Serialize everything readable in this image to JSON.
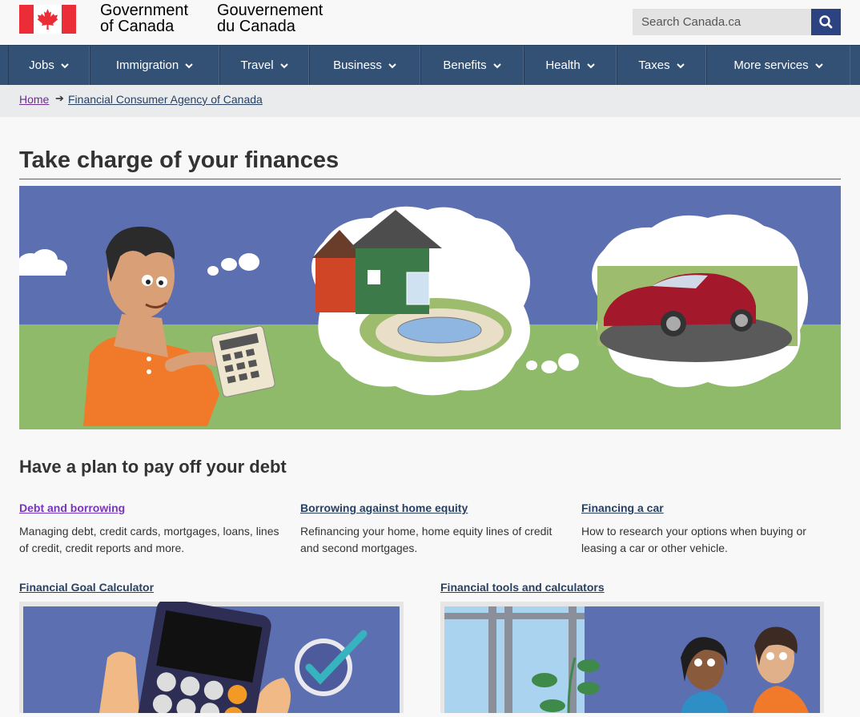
{
  "header": {
    "signature_en_line1": "Government",
    "signature_en_line2": "of Canada",
    "signature_fr_line1": "Gouvernement",
    "signature_fr_line2": "du Canada",
    "search_placeholder": "Search Canada.ca"
  },
  "nav": {
    "items": [
      {
        "label": "Jobs"
      },
      {
        "label": "Immigration"
      },
      {
        "label": "Travel"
      },
      {
        "label": "Business"
      },
      {
        "label": "Benefits"
      },
      {
        "label": "Health"
      },
      {
        "label": "Taxes"
      },
      {
        "label": "More services"
      }
    ]
  },
  "breadcrumb": {
    "home": "Home",
    "current": "Financial Consumer Agency of Canada"
  },
  "main": {
    "title": "Take charge of your finances",
    "section_heading": "Have a plan to pay off your debt",
    "cards": [
      {
        "title": "Debt and borrowing",
        "desc": "Managing debt, credit cards, mortgages, loans, lines of credit, credit reports and more."
      },
      {
        "title": "Borrowing against home equity",
        "desc": "Refinancing your home, home equity lines of credit and second mortgages."
      },
      {
        "title": "Financing a car",
        "desc": "How to research your options when buying or leasing a car or other vehicle."
      }
    ],
    "features": [
      {
        "title": "Financial Goal Calculator"
      },
      {
        "title": "Financial tools and calculators"
      }
    ]
  },
  "colors": {
    "nav_bg": "#335075",
    "title_rule": "#af3c43",
    "link": "#284162",
    "visited_link": "#7834bc",
    "flag_red": "#eb2d37"
  }
}
